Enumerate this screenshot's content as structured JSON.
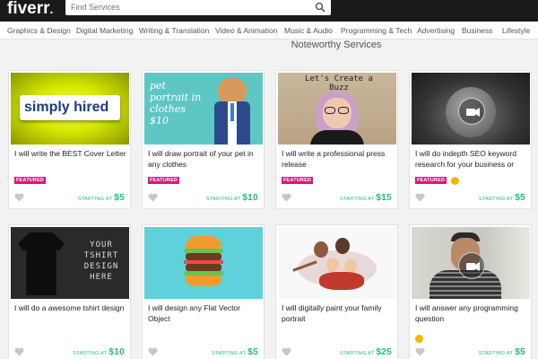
{
  "header": {
    "logo": "fiverr",
    "logo_dot": "."
  },
  "search": {
    "placeholder": "Find Services"
  },
  "categories": [
    "Graphics & Design",
    "Digital Marketing",
    "Writing & Translation",
    "Video & Animation",
    "Music & Audio",
    "Programming & Tech",
    "Advertising",
    "Business",
    "Lifestyle"
  ],
  "section": {
    "title": "Noteworthy Services"
  },
  "gigs": [
    {
      "title": "I will write the BEST Cover Letter",
      "badge": "FEATURED",
      "starting": "STARTING AT",
      "price": "$5",
      "thumb_text": "simply hired"
    },
    {
      "title": "I will draw portrait of your pet in any clothes",
      "badge": "FEATURED",
      "starting": "STARTING AT",
      "price": "$10",
      "thumb_text": "pet portrait in clothes $10"
    },
    {
      "title": "I will write a professional press release",
      "badge": "FEATURED",
      "starting": "STARTING AT",
      "price": "$15",
      "thumb_text": "Let's Create a Buzz"
    },
    {
      "title": "I will do indepth SEO keyword research for your business or",
      "badge": "FEATURED",
      "starting": "STARTING AT",
      "price": "$5"
    },
    {
      "title": "I will do a awesome tshirt design",
      "starting": "STARTING AT",
      "price": "$10",
      "thumb_text": "YOUR TSHIRT DESIGN HERE"
    },
    {
      "title": "I will design any Flat Vector Object",
      "starting": "STARTING AT",
      "price": "$5"
    },
    {
      "title": "I will digitally paint your family portrait",
      "starting": "STARTING AT",
      "price": "$25"
    },
    {
      "title": "I will answer any programming question",
      "starting": "STARTING AT",
      "price": "$5"
    }
  ],
  "colors": {
    "topbar": "#1a1a1a",
    "featured": "#e2137e",
    "price": "#1dbf73",
    "pro_badge": "#f5b700"
  }
}
